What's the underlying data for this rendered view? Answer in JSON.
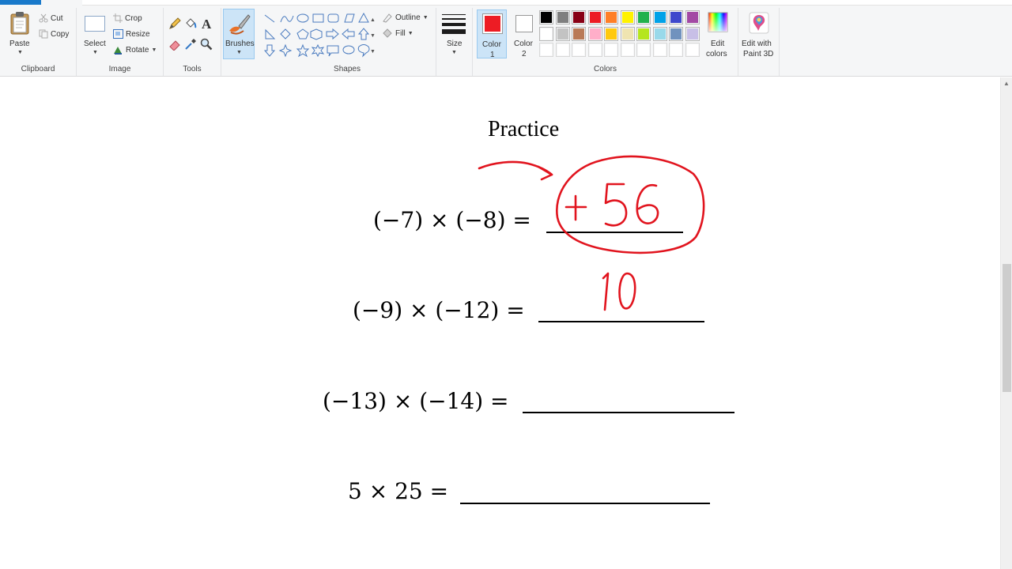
{
  "ribbon": {
    "clipboard": {
      "group_label": "Clipboard",
      "paste": "Paste",
      "cut": "Cut",
      "copy": "Copy"
    },
    "image": {
      "group_label": "Image",
      "select": "Select",
      "crop": "Crop",
      "resize": "Resize",
      "rotate": "Rotate"
    },
    "tools": {
      "group_label": "Tools"
    },
    "brushes": {
      "label": "Brushes"
    },
    "shapes": {
      "group_label": "Shapes",
      "outline": "Outline",
      "fill": "Fill"
    },
    "size": {
      "label": "Size"
    },
    "color1": {
      "label_line1": "Color",
      "label_line2": "1",
      "color": "#ed1c24"
    },
    "color2": {
      "label_line1": "Color",
      "label_line2": "2",
      "color": "#ffffff"
    },
    "colors": {
      "group_label": "Colors",
      "row1": [
        "#000000",
        "#7f7f7f",
        "#880015",
        "#ed1c24",
        "#ff7f27",
        "#fff200",
        "#22b14c",
        "#00a2e8",
        "#3f48cc",
        "#a349a4"
      ],
      "row2": [
        "#ffffff",
        "#c3c3c3",
        "#b97a57",
        "#ffaec9",
        "#ffc90e",
        "#efe4b0",
        "#b5e61d",
        "#99d9ea",
        "#7092be",
        "#c8bfe7"
      ],
      "row3": [
        "#ffffff",
        "#ffffff",
        "#ffffff",
        "#ffffff",
        "#ffffff",
        "#ffffff",
        "#ffffff",
        "#ffffff",
        "#ffffff",
        "#ffffff"
      ]
    },
    "edit_colors": {
      "line1": "Edit",
      "line2": "colors"
    },
    "paint3d": {
      "line1": "Edit with",
      "line2": "Paint 3D"
    }
  },
  "canvas": {
    "title": "Practice",
    "problems": [
      {
        "expr": "(−7) × (−8) ="
      },
      {
        "expr": "(−9) × (−12) ="
      },
      {
        "expr": "(−13) × (−14) ="
      },
      {
        "expr": "5  × 25 ="
      }
    ],
    "handwriting": {
      "answer1": "+56",
      "answer2_partial": "10",
      "ink_color": "#e1141e"
    }
  }
}
